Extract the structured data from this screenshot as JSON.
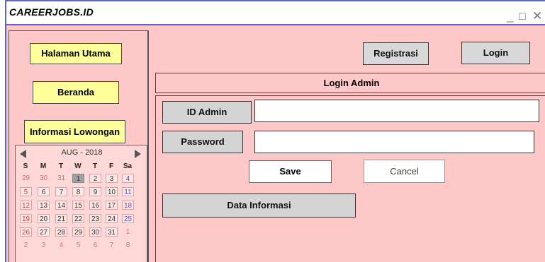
{
  "app": {
    "title": "CAREERJOBS.ID"
  },
  "window_controls": {
    "minimize": "_",
    "maximize": "□",
    "close": "✕"
  },
  "sidebar": {
    "items": [
      {
        "label": "Halaman Utama"
      },
      {
        "label": "Beranda"
      },
      {
        "label": "Informasi Lowongan"
      }
    ]
  },
  "calendar": {
    "month_label": "AUG - 2018",
    "weekdays": [
      "S",
      "M",
      "T",
      "W",
      "T",
      "F",
      "Sa"
    ],
    "weeks": [
      [
        "29",
        "30",
        "31",
        "1",
        "2",
        "3",
        "4"
      ],
      [
        "5",
        "6",
        "7",
        "8",
        "9",
        "10",
        "11"
      ],
      [
        "12",
        "13",
        "14",
        "15",
        "16",
        "17",
        "18"
      ],
      [
        "19",
        "20",
        "21",
        "22",
        "23",
        "24",
        "25"
      ],
      [
        "26",
        "27",
        "28",
        "29",
        "30",
        "31",
        "1"
      ],
      [
        "2",
        "3",
        "4",
        "5",
        "6",
        "7",
        "8"
      ]
    ],
    "selected_day": "1"
  },
  "header": {
    "registrasi_label": "Registrasi",
    "login_label": "Login"
  },
  "login_panel": {
    "title": "Login Admin",
    "id_label": "ID Admin",
    "id_value": "",
    "password_label": "Password",
    "password_value": "",
    "save_label": "Save",
    "cancel_label": "Cancel",
    "data_info_label": "Data Informasi"
  }
}
